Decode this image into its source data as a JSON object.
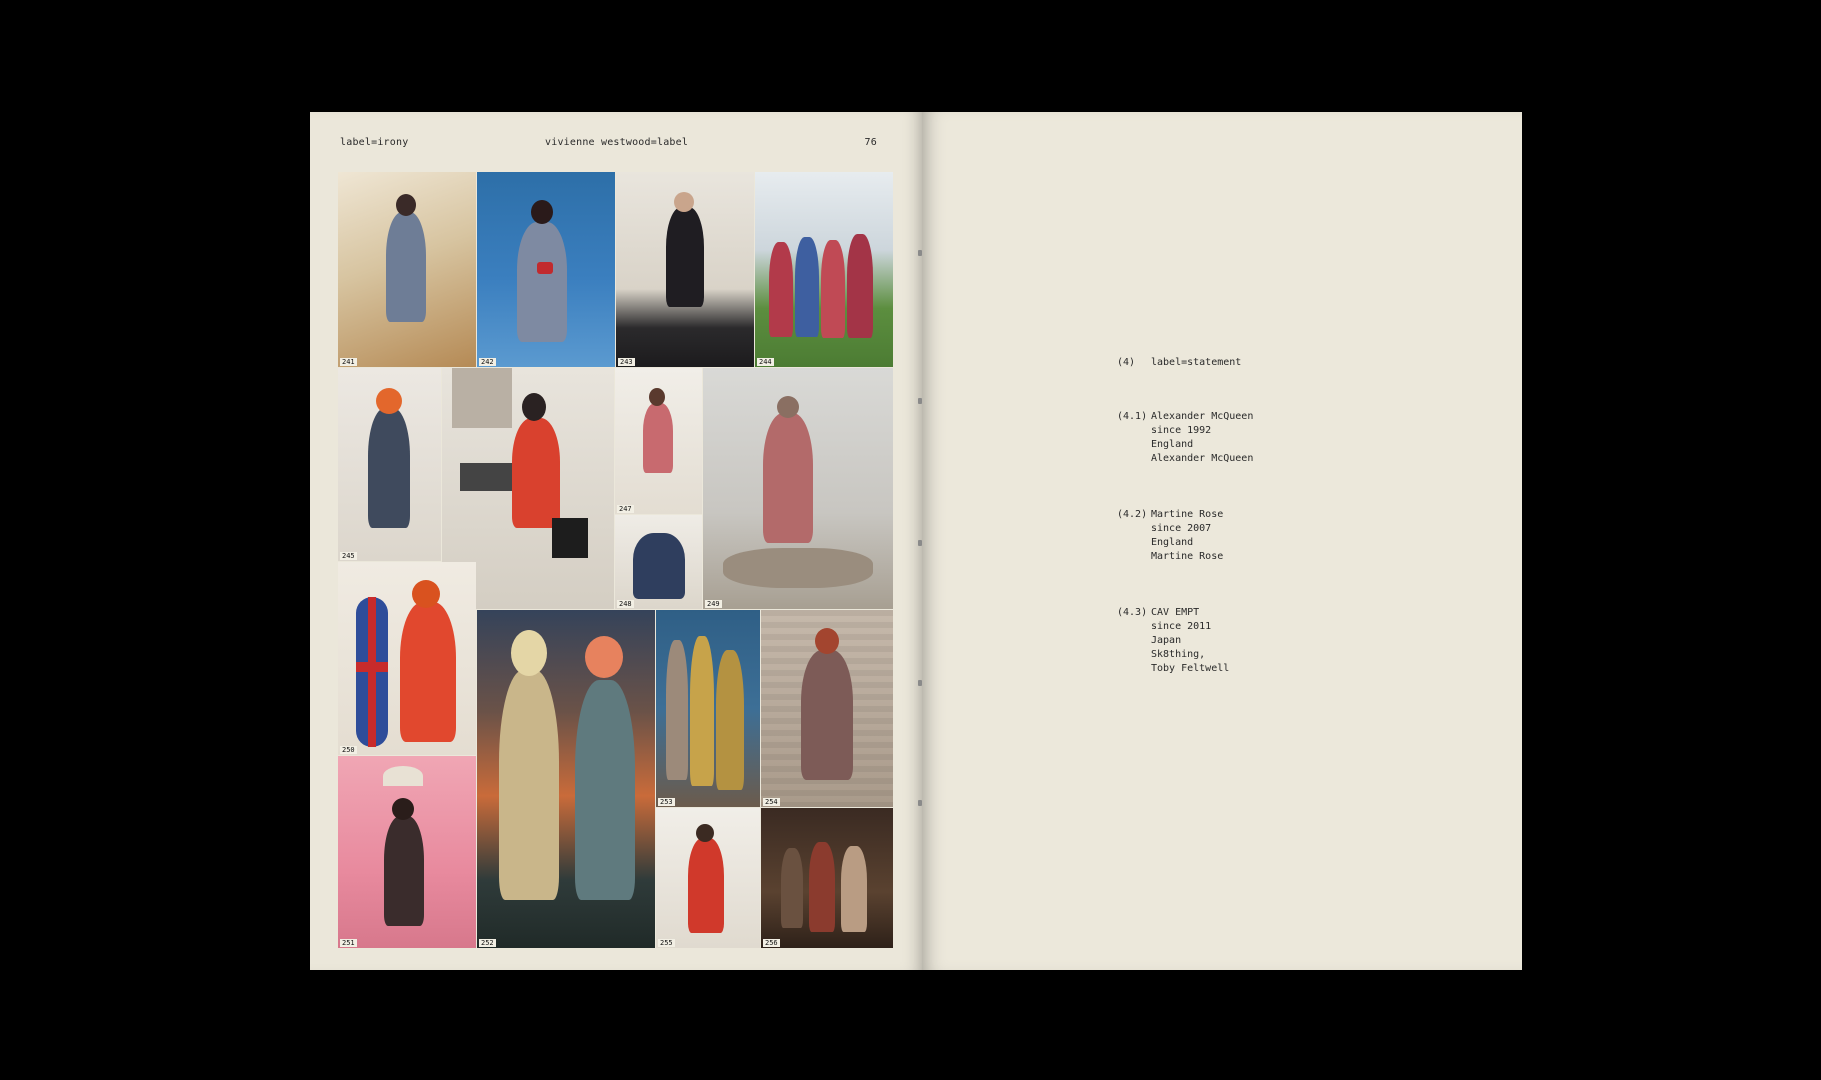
{
  "left_page": {
    "header_left": "label=irony",
    "header_center": "vivienne westwood=label",
    "page_number": "76",
    "figures": [
      "241",
      "242",
      "243",
      "244",
      "245",
      "246",
      "247",
      "248",
      "249",
      "250",
      "251",
      "252",
      "253",
      "254",
      "255",
      "256"
    ]
  },
  "right_page": {
    "section": {
      "number": "(4)",
      "title": "label=statement"
    },
    "entries": [
      {
        "number": "(4.1)",
        "lines": [
          "Alexander McQueen",
          "since 1992",
          "England",
          "Alexander McQueen"
        ]
      },
      {
        "number": "(4.2)",
        "lines": [
          "Martine Rose",
          "since 2007",
          "England",
          "Martine Rose"
        ]
      },
      {
        "number": "(4.3)",
        "lines": [
          "CAV EMPT",
          "since 2011",
          "Japan",
          "Sk8thing,",
          "Toby Feltwell"
        ]
      }
    ]
  }
}
